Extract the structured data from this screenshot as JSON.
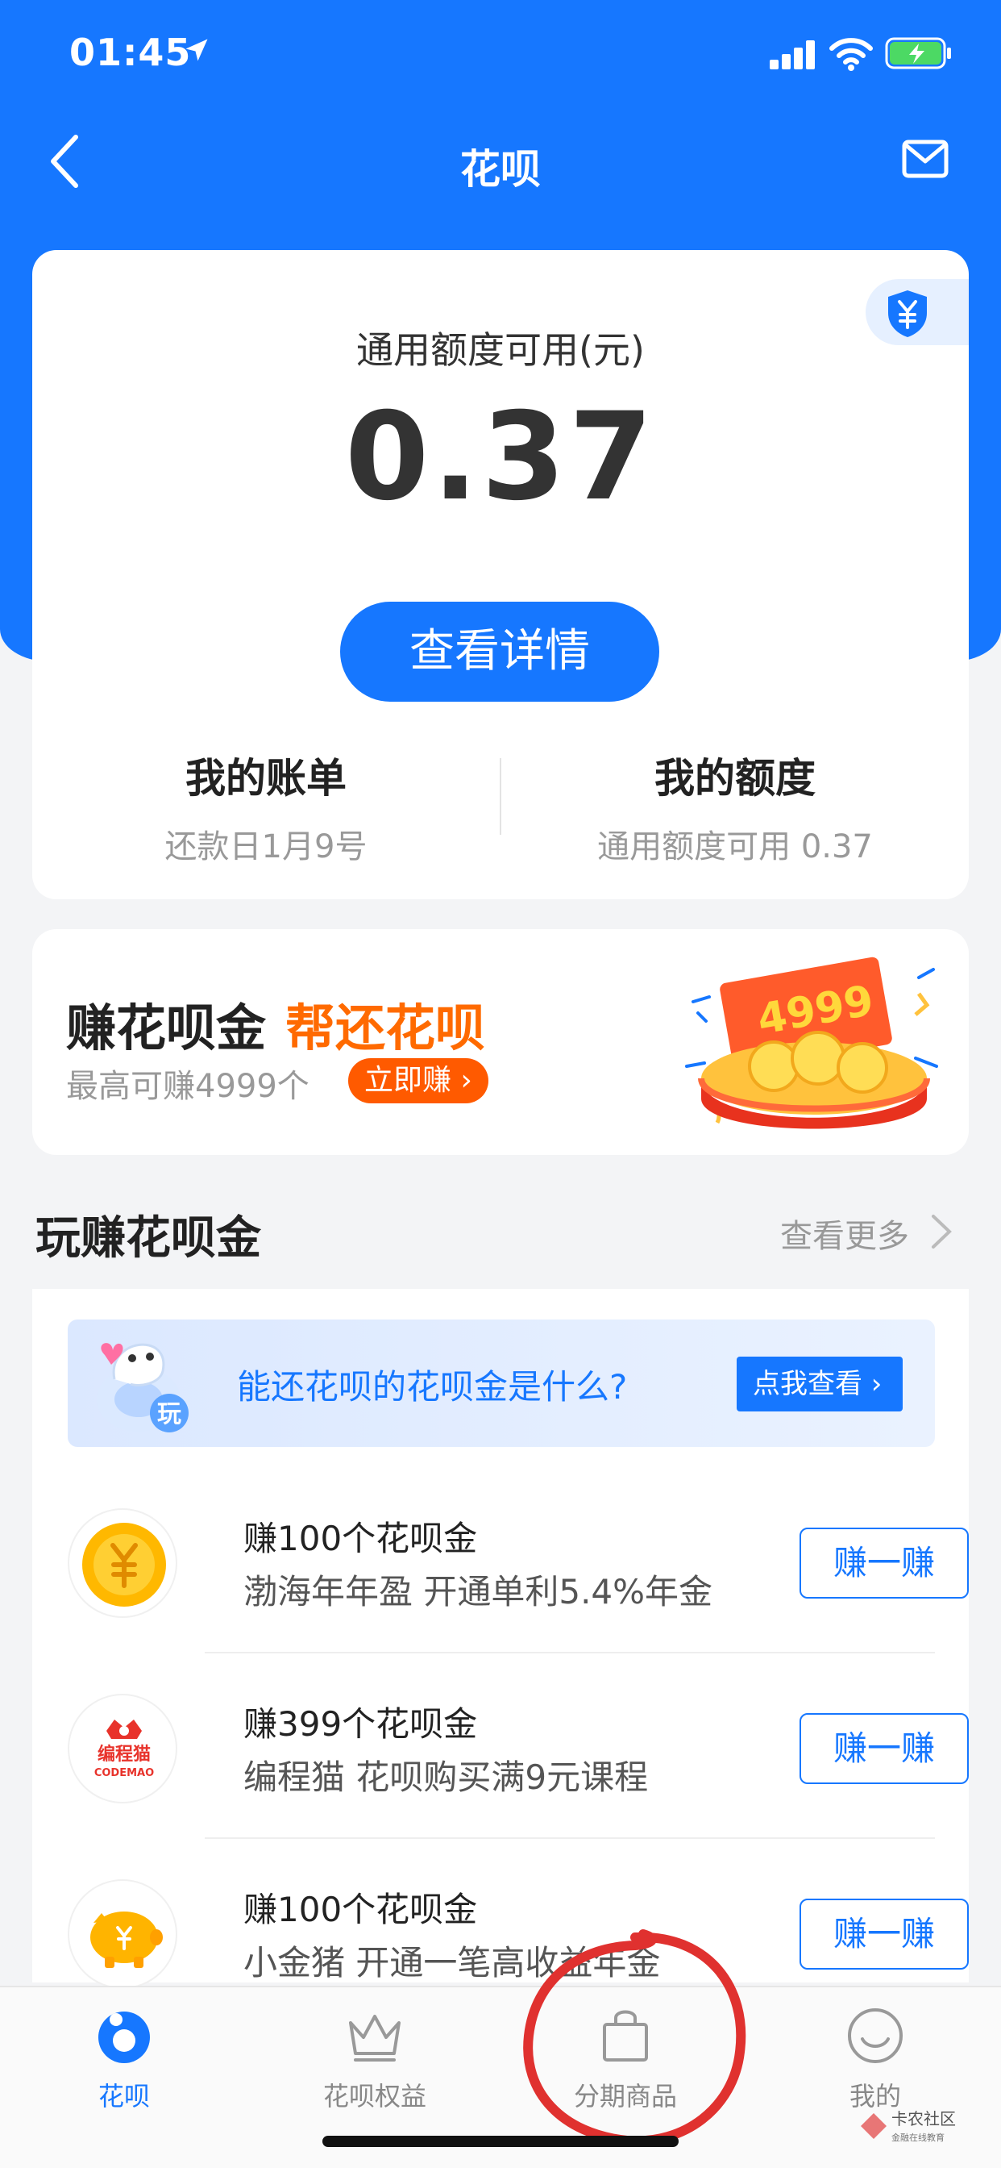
{
  "status_bar": {
    "time": "01:45"
  },
  "nav": {
    "title": "花呗"
  },
  "quota": {
    "label": "通用额度可用(元)",
    "value": "0.37",
    "detail_button": "查看详情",
    "bill": {
      "title": "我的账单",
      "sub": "还款日1月9号"
    },
    "limit": {
      "title": "我的额度",
      "sub": "通用额度可用 0.37"
    }
  },
  "promo": {
    "title_main": "赚花呗金",
    "title_accent": "帮还花呗",
    "subtitle": "最高可赚4999个",
    "button": "立即赚 ›",
    "badge_number": "4999"
  },
  "section": {
    "title": "玩赚花呗金",
    "more": "查看更多"
  },
  "banner": {
    "mascot_tag": "玩",
    "text": "能还花呗的花呗金是什么?",
    "button": "点我查看 ›"
  },
  "tasks": [
    {
      "title": "赚100个花呗金",
      "desc": "渤海年年盈 开通单利5.4%年金",
      "button": "赚一赚",
      "icon": "coin-icon"
    },
    {
      "title": "赚399个花呗金",
      "desc": "编程猫 花呗购买满9元课程",
      "button": "赚一赚",
      "icon": "codemao-logo",
      "logo_text": "编程猫",
      "logo_sub": "CODEMAO"
    },
    {
      "title": "赚100个花呗金",
      "desc": "小金猪 开通一笔高收益年金",
      "button": "赚一赚",
      "icon": "piggy-bank-icon"
    }
  ],
  "tabbar": [
    {
      "label": "花呗",
      "icon": "huabei-icon",
      "active": true
    },
    {
      "label": "花呗权益",
      "icon": "crown-icon",
      "active": false
    },
    {
      "label": "分期商品",
      "icon": "shopping-bag-icon",
      "active": false
    },
    {
      "label": "我的",
      "icon": "smiley-icon",
      "active": false
    }
  ],
  "watermark": {
    "text": "卡农社区",
    "sub": "金融在线教育"
  },
  "colors": {
    "primary": "#1677ff",
    "accent": "#ff6a00",
    "circle_annotation": "#e0312f"
  }
}
